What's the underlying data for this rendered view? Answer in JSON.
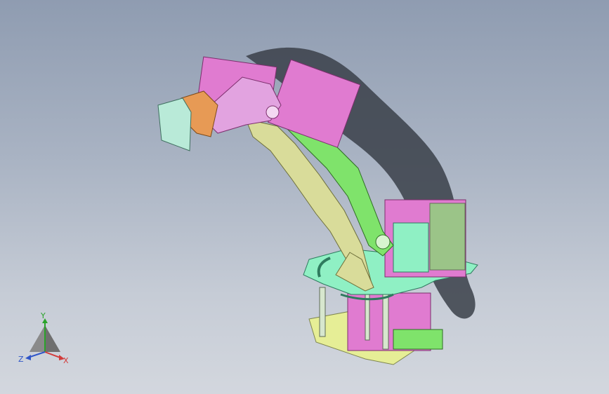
{
  "triad": {
    "x_label": "X",
    "y_label": "Y",
    "z_label": "Z"
  },
  "colors": {
    "servo": "#e07bd0",
    "arm_green": "#7fe36b",
    "arm_tan": "#d9dc9a",
    "base_mint": "#8ff0c4",
    "base_yellow": "#e6ee96",
    "gripper_mint": "#b9ead8",
    "gripper_orange": "#e79a55",
    "link_pink": "#e2a3e0"
  }
}
